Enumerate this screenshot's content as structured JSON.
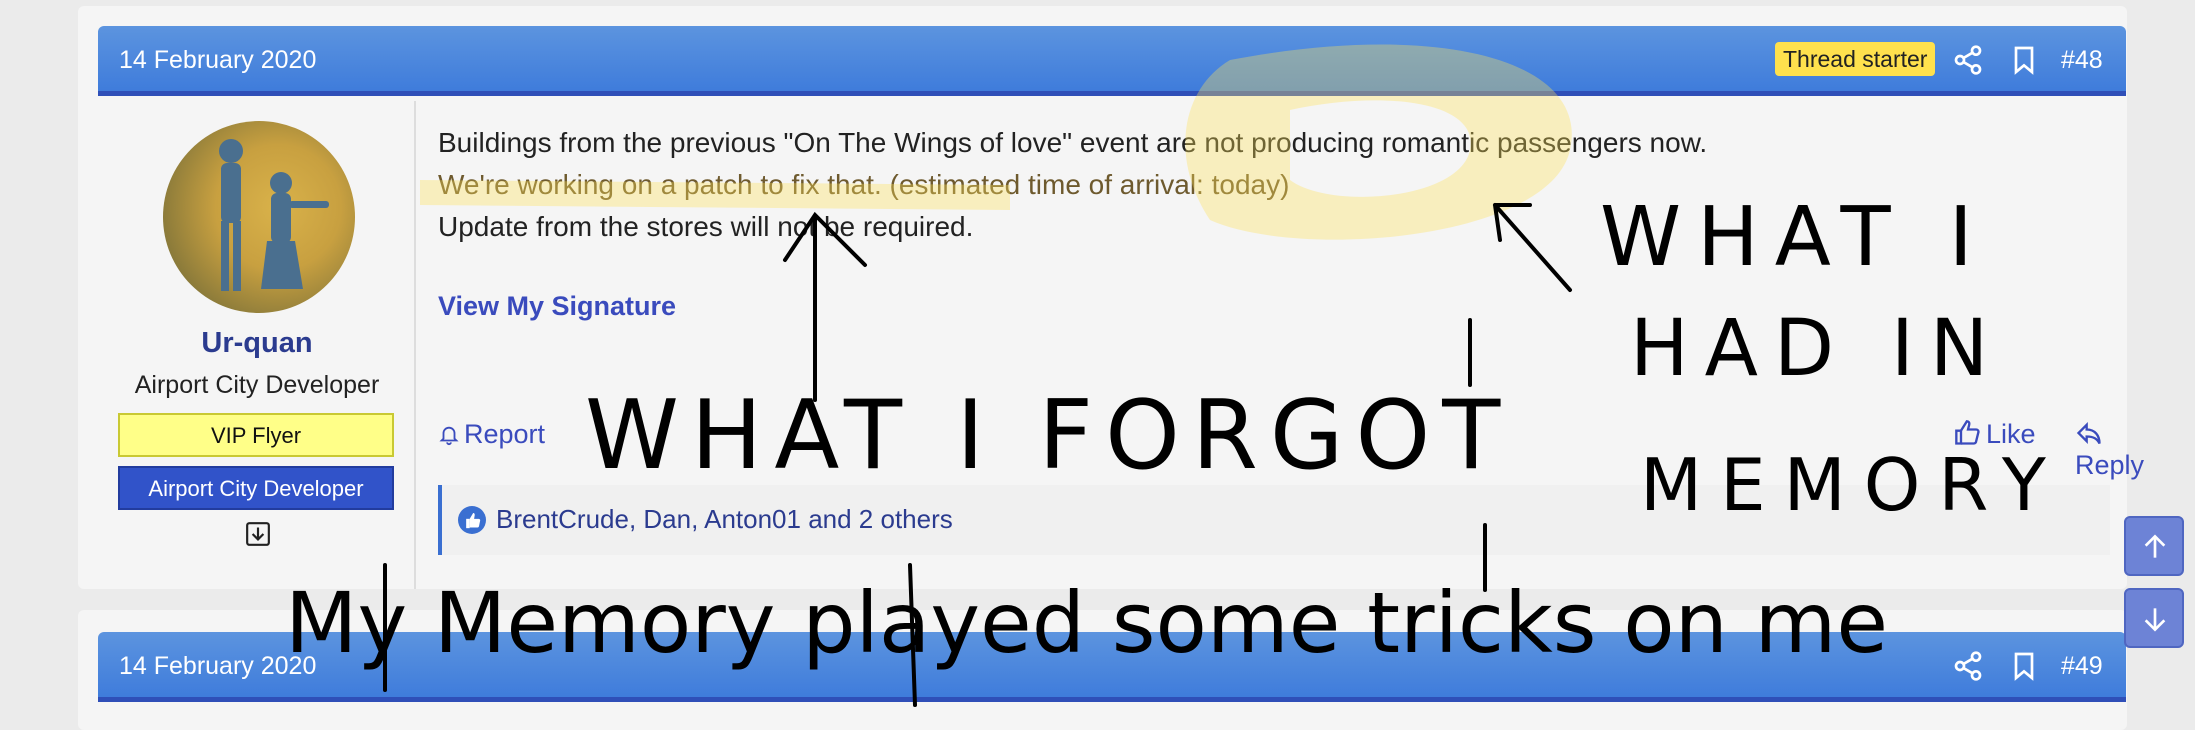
{
  "post": {
    "date": "14 February 2020",
    "badge": "Thread starter",
    "number": "#48",
    "user": {
      "name": "Ur-quan",
      "title": "Airport City Developer",
      "banners": [
        "VIP Flyer",
        "Airport City Developer"
      ]
    },
    "body": [
      "Buildings from the previous \"On The Wings of love\" event are not producing romantic passengers now.",
      "We're working on a patch to fix that. (estimated time of arrival: today)",
      "Update from the stores will not be required."
    ],
    "signature_link": "View My Signature",
    "actions": {
      "report": "Report",
      "like": "Like",
      "reply": "Reply"
    },
    "likes": "BrentCrude, Dan, Anton01 and 2 others"
  },
  "next_post": {
    "date": "14 February 2020",
    "number": "#49"
  },
  "annotations": {
    "forgot": "WHAT I FORGOT",
    "memory_1": "WHAT I",
    "memory_2": "HAD IN",
    "memory_3": "MEMORY",
    "trick": "My Memory played some tricks on me"
  },
  "colors": {
    "header": "#4a86dc",
    "link": "#3a4bbd",
    "badge": "#ffe14d",
    "vip_banner": "#ffff88",
    "dev_banner": "#3153c9"
  }
}
